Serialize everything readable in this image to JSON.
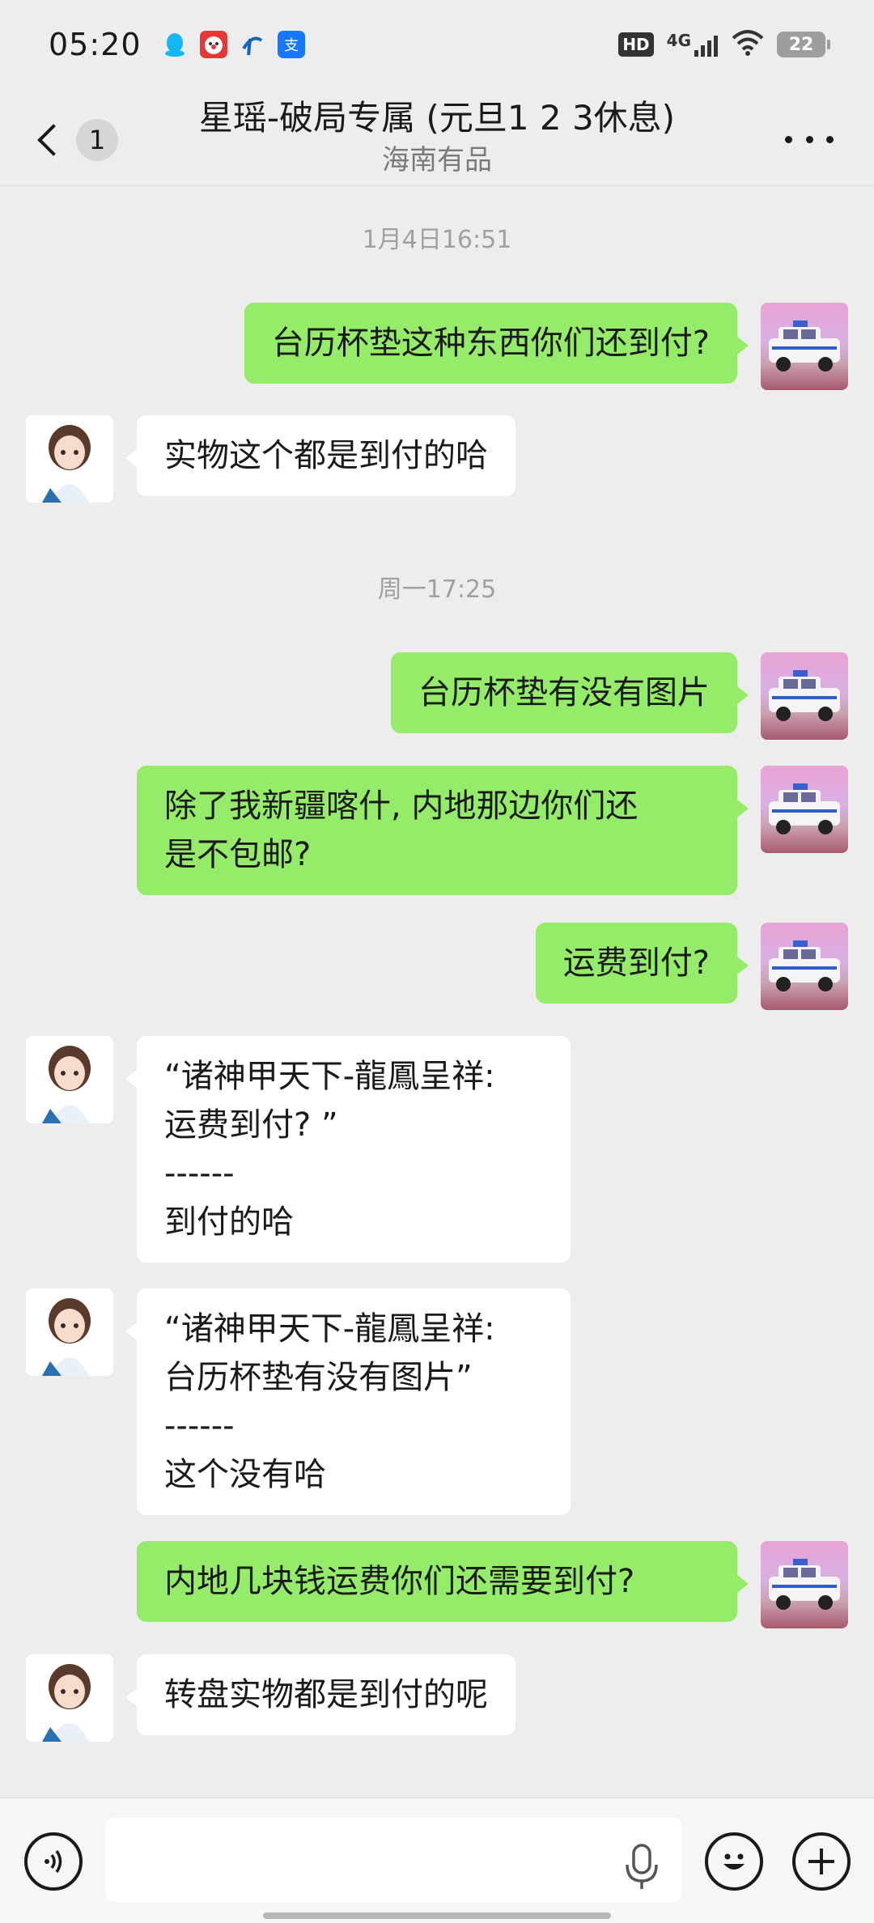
{
  "status_bar": {
    "time": "05:20",
    "hd_label": "HD",
    "network_label": "4G",
    "battery_level": "22",
    "left_icons": [
      "qq-icon",
      "clown-app-icon",
      "china-telecom-icon",
      "alipay-icon"
    ],
    "right_icons": [
      "hd-icon",
      "signal-icon",
      "wifi-icon",
      "battery-icon"
    ]
  },
  "header": {
    "back_count": "1",
    "title": "星瑶-破局专属 (元旦1 2 3休息)",
    "subtitle": "海南有品"
  },
  "chat": {
    "timestamps": [
      "1月4日16:51",
      "周一17:25"
    ],
    "messages": [
      {
        "sender": "me",
        "text": "台历杯垫这种东西你们还到付?"
      },
      {
        "sender": "other",
        "text": "实物这个都是到付的哈"
      },
      {
        "sender": "me",
        "text": "台历杯垫有没有图片"
      },
      {
        "sender": "me",
        "text": "除了我新疆喀什, 内地那边你们还\n是不包邮?"
      },
      {
        "sender": "me",
        "text": "运费到付?"
      },
      {
        "sender": "other",
        "text": "“诸神甲天下-龍鳳呈祥:\n运费到付? ”\n------\n到付的哈"
      },
      {
        "sender": "other",
        "text": "“诸神甲天下-龍鳳呈祥:\n台历杯垫有没有图片”\n------\n这个没有哈"
      },
      {
        "sender": "me",
        "text": "内地几块钱运费你们还需要到付?"
      },
      {
        "sender": "other",
        "text": "转盘实物都是到付的呢"
      }
    ]
  },
  "colors": {
    "background": "#ededed",
    "my_bubble": "#95ec69",
    "other_bubble": "#ffffff"
  }
}
